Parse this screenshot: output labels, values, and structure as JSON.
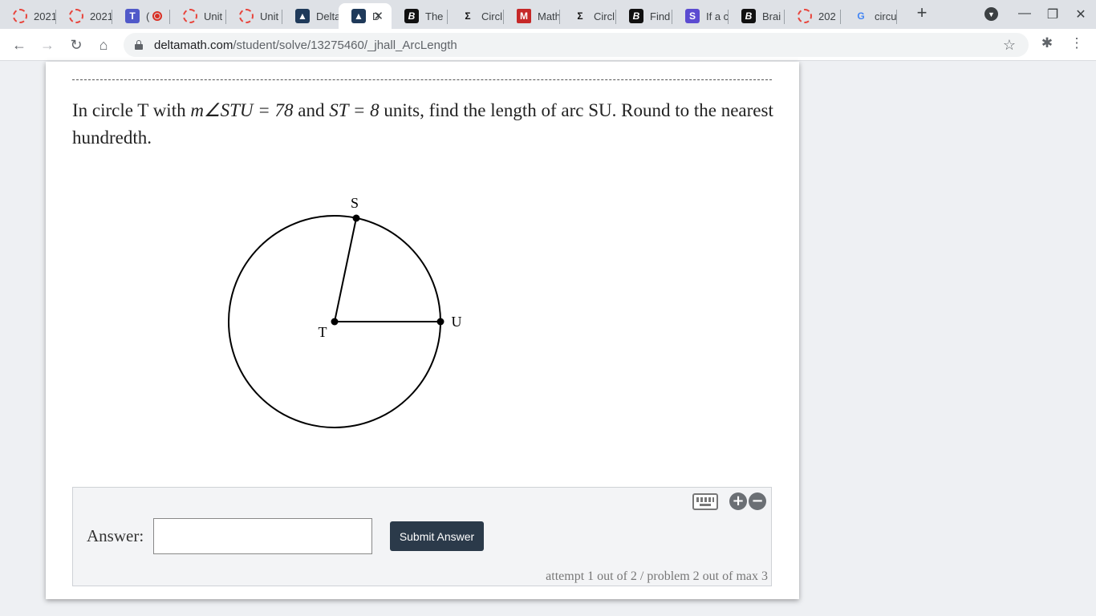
{
  "tabs": [
    {
      "title": "2021",
      "icon": "dashed-circle-icon"
    },
    {
      "title": "2021",
      "icon": "dashed-circle-icon"
    },
    {
      "title": "(",
      "icon": "teams-icon"
    },
    {
      "title": "Unit",
      "icon": "dashed-circle-icon"
    },
    {
      "title": "Unit",
      "icon": "dashed-circle-icon"
    },
    {
      "title": "Delta",
      "icon": "deltamath-icon"
    },
    {
      "title": "D",
      "icon": "deltamath-icon",
      "active": true
    },
    {
      "title": "The",
      "icon": "brainly-icon"
    },
    {
      "title": "Circl",
      "icon": "sigma-icon"
    },
    {
      "title": "Math",
      "icon": "m-icon"
    },
    {
      "title": "Circl",
      "icon": "sigma-icon"
    },
    {
      "title": "Find",
      "icon": "brainly-icon"
    },
    {
      "title": "If a c",
      "icon": "s-icon"
    },
    {
      "title": "Brai",
      "icon": "brainly-icon"
    },
    {
      "title": "202",
      "icon": "dashed-circle-icon"
    },
    {
      "title": "circu",
      "icon": "google-icon"
    }
  ],
  "address": {
    "domain": "deltamath.com",
    "path": "/student/solve/13275460/_jhall_ArcLength"
  },
  "question": {
    "prefix": "In circle T with ",
    "angle_expr": "m∠STU = 78",
    "middle": " and ",
    "seg_expr": "ST = 8",
    "suffix": " units, find the length of arc SU. Round to the nearest hundredth."
  },
  "figure": {
    "center_label": "T",
    "point_s_label": "S",
    "point_u_label": "U",
    "angle_deg": 78
  },
  "answer": {
    "label": "Answer:",
    "value": "",
    "submit_label": "Submit Answer",
    "attempt_text": "attempt 1 out of 2 / problem 2 out of max 3",
    "zoom_in": "+",
    "zoom_out": "−"
  },
  "colors": {
    "submit_bg": "#2b3a4a",
    "panel_bg": "#f3f4f6"
  }
}
